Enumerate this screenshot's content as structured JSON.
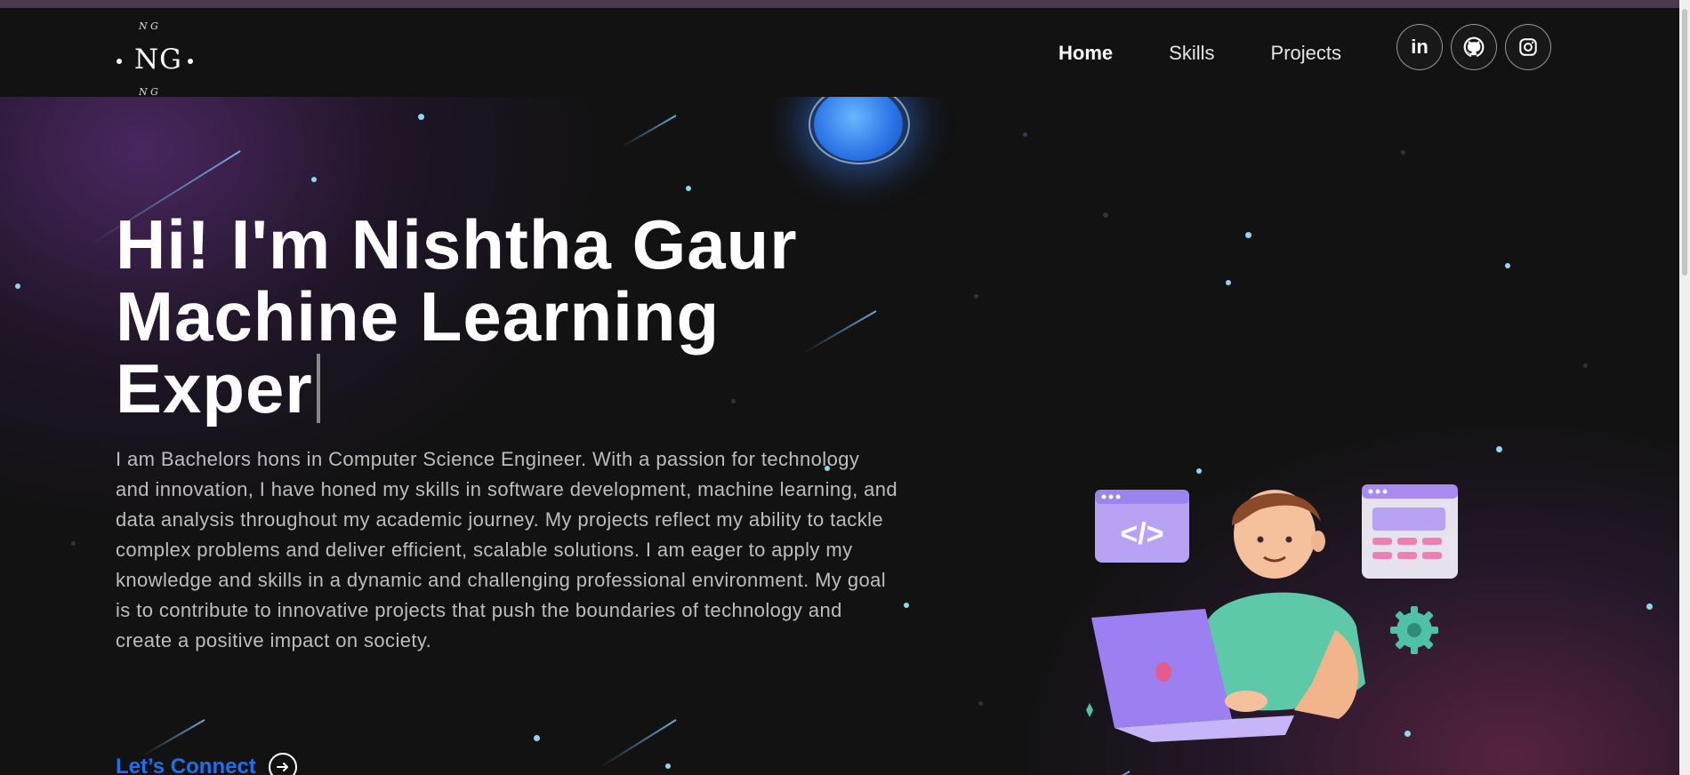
{
  "nav": {
    "logo": {
      "main": "NG",
      "top_small": "N  G",
      "bottom_small": "N  G"
    },
    "links": [
      {
        "label": "Home",
        "active": true
      },
      {
        "label": "Skills",
        "active": false
      },
      {
        "label": "Projects",
        "active": false
      }
    ],
    "socials": [
      {
        "name": "linkedin-icon",
        "glyph": "in"
      },
      {
        "name": "github-icon",
        "glyph": ""
      },
      {
        "name": "instagram-icon",
        "glyph": ""
      }
    ]
  },
  "hero": {
    "title_line1": "Hi! I'm Nishtha Gaur",
    "title_line2": "Machine Learning",
    "title_line3": "Exper",
    "description": "I am Bachelors hons in Computer Science Engineer. With a passion for technology and innovation, I have honed my skills in software development, machine learning, and data analysis throughout my academic journey. My projects reflect my ability to tackle complex problems and deliver efficient, scalable solutions. I am eager to apply my knowledge and skills in a dynamic and challenging professional environment. My goal is to contribute to innovative projects that push the boundaries of technology and create a positive impact on society.",
    "cta_label": "Let’s Connect",
    "illustration": {
      "code_window_text": "</>"
    }
  },
  "colors": {
    "background": "#121212",
    "accent_link": "#1e6ff0",
    "star": "#8fd6f0",
    "purple": "#a98bf0",
    "teal": "#4fc1a6"
  }
}
